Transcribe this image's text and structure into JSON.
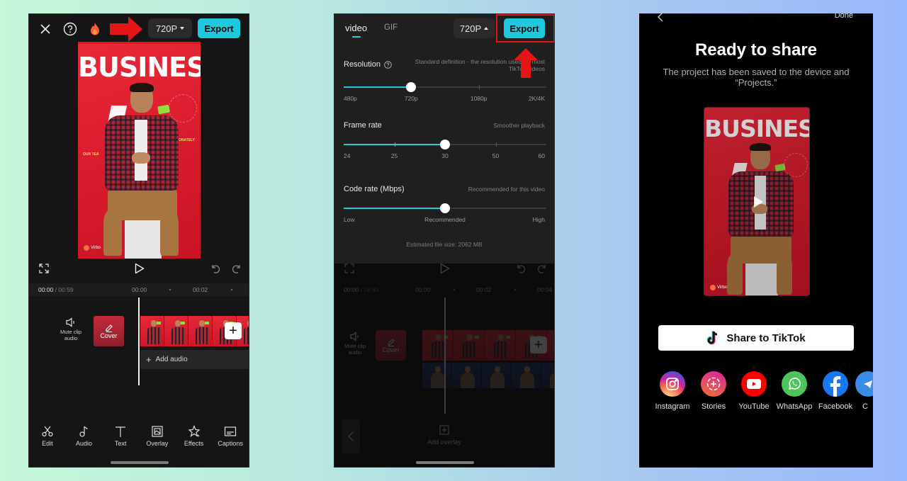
{
  "screen1": {
    "top_bar": {
      "close_icon": "close-icon",
      "help_icon": "help-circle-icon",
      "fire_icon": "flame-icon",
      "resolution_label": "720P",
      "export_label": "Export"
    },
    "preview": {
      "headline": "BUSINESS",
      "side_text_left": "OUR TEA",
      "side_text_right": "ONATELY",
      "watermark": "Virbo"
    },
    "controls": {
      "fullscreen_icon": "fullscreen-icon",
      "play_icon": "play-icon",
      "undo_icon": "undo-icon",
      "redo_icon": "redo-icon"
    },
    "timeline": {
      "current_time": "00:00",
      "separator": " / ",
      "total_time": "00:59",
      "ticks": [
        "00:00",
        "00:02"
      ],
      "mute_label": "Mute clip audio",
      "cover_label": "Cover",
      "add_audio_label": "Add audio"
    },
    "toolbar": [
      {
        "label": "Edit",
        "icon": "scissors-icon"
      },
      {
        "label": "Audio",
        "icon": "music-note-icon"
      },
      {
        "label": "Text",
        "icon": "text-icon"
      },
      {
        "label": "Overlay",
        "icon": "overlay-icon"
      },
      {
        "label": "Effects",
        "icon": "effects-star-icon"
      },
      {
        "label": "Captions",
        "icon": "captions-icon"
      }
    ]
  },
  "screen2": {
    "tabs": [
      {
        "label": "video",
        "active": true
      },
      {
        "label": "GIF",
        "active": false
      }
    ],
    "resolution_label": "720P",
    "export_label": "Export",
    "resolution": {
      "title": "Resolution",
      "hint": "Standard definition - the resolution used for most TikTok videos",
      "options": [
        "480p",
        "720p",
        "1080p",
        "2K/4K"
      ],
      "selected_index": 1
    },
    "frame_rate": {
      "title": "Frame rate",
      "hint": "Smoother playback",
      "options": [
        "24",
        "25",
        "30",
        "50",
        "60"
      ],
      "selected_index": 2
    },
    "code_rate": {
      "title": "Code rate (Mbps)",
      "hint": "Recommended for this video",
      "options": [
        "Low",
        "Recommended",
        "High"
      ],
      "selected_index": 1
    },
    "estimated_size": "Estimated file size: 2062 MB",
    "timeline": {
      "current_time": "00:00",
      "separator": " / ",
      "total_time": "28:49",
      "ticks": [
        "00:00",
        "00:02",
        "00:04"
      ],
      "mute_label": "Mute clip audio",
      "cover_label": "Cover"
    },
    "add_overlay_label": "Add overlay"
  },
  "screen3": {
    "back_icon": "chevron-left-icon",
    "done_label": "Done",
    "title": "Ready to share",
    "subtitle": "The project has been saved to the device and “Projects.”",
    "preview_headline": "BUSINESS",
    "preview_watermark": "Virbo",
    "tiktok_label": "Share to TikTok",
    "apps": [
      {
        "label": "Instagram",
        "color": "#d6249f"
      },
      {
        "label": "Stories",
        "color": "#e1306c"
      },
      {
        "label": "YouTube",
        "color": "#ff0000"
      },
      {
        "label": "WhatsApp",
        "color": "#4cc55a"
      },
      {
        "label": "Facebook",
        "color": "#1877f2"
      },
      {
        "label": "C",
        "color": "#3b8be8"
      }
    ]
  },
  "colors": {
    "accent": "#1fc8dc",
    "annotation_red": "#e51515",
    "preview_red": "#d81b2c"
  }
}
